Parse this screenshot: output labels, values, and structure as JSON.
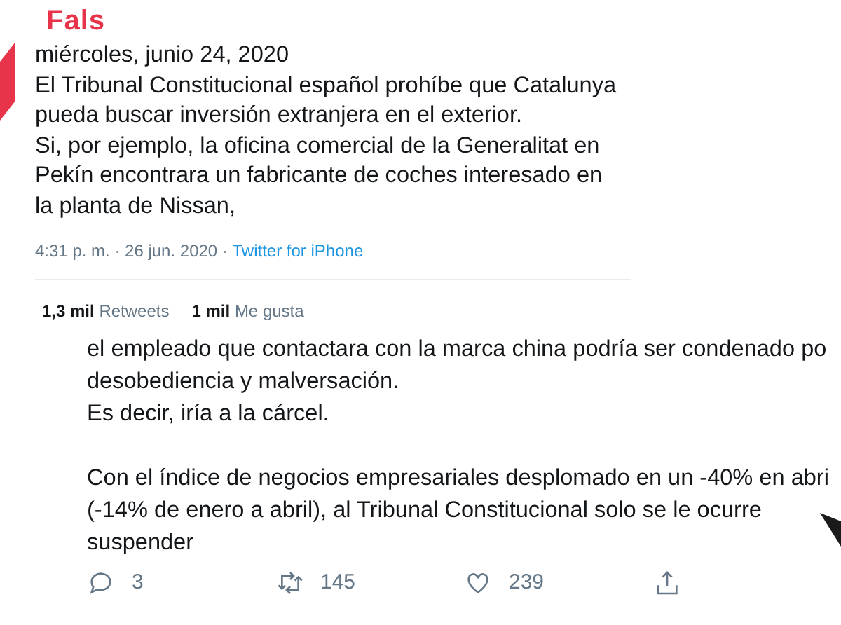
{
  "verdict_label": "Fals",
  "tweet": {
    "lines": [
      "miércoles, junio 24, 2020",
      "El Tribunal Constitucional español prohíbe que Catalunya",
      "pueda buscar inversión extranjera en el exterior.",
      "Si, por ejemplo, la oficina comercial de la Generalitat en",
      "Pekín encontrara un fabricante de coches interesado en",
      "la planta de Nissan,"
    ],
    "time": "4:31 p. m. · 26 jun. 2020 · ",
    "source": "Twitter for iPhone",
    "stats": [
      {
        "count": "1,3 mil",
        "label": "Retweets"
      },
      {
        "count": "1 mil",
        "label": "Me gusta"
      }
    ]
  },
  "reply": {
    "paragraphs": [
      [
        "el empleado que contactara con la marca china podría ser condenado po",
        "desobediencia y malversación.",
        "Es decir, iría a la cárcel."
      ],
      [
        "Con el índice de negocios empresariales desplomado en un -40% en abri",
        "(-14% de enero a abril), al Tribunal Constitucional solo se le ocurre",
        "suspender"
      ]
    ],
    "actions": [
      {
        "kind": "reply",
        "count": "3"
      },
      {
        "kind": "retweet",
        "count": "145"
      },
      {
        "kind": "like",
        "count": "239"
      },
      {
        "kind": "share"
      }
    ]
  }
}
